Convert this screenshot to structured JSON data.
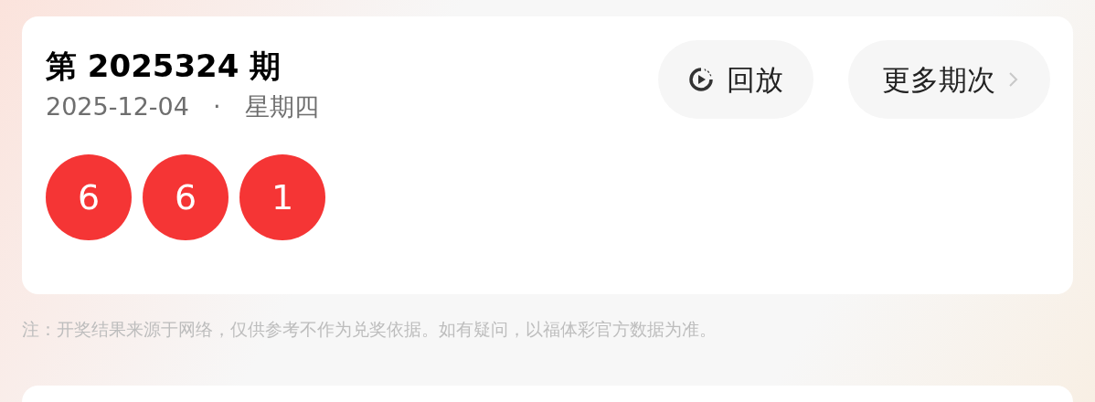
{
  "draw": {
    "title": "第 2025324 期",
    "date": "2025-12-04",
    "separator": "·",
    "weekday": "星期四",
    "numbers": [
      "6",
      "6",
      "1"
    ],
    "buttons": [
      {
        "kind": "replay",
        "label": "回放"
      },
      {
        "kind": "more",
        "label": "更多期次"
      }
    ]
  },
  "note": "注：开奖结果来源于网络，仅供参考不作为兑奖依据。如有疑问，以福体彩官方数据为准。"
}
